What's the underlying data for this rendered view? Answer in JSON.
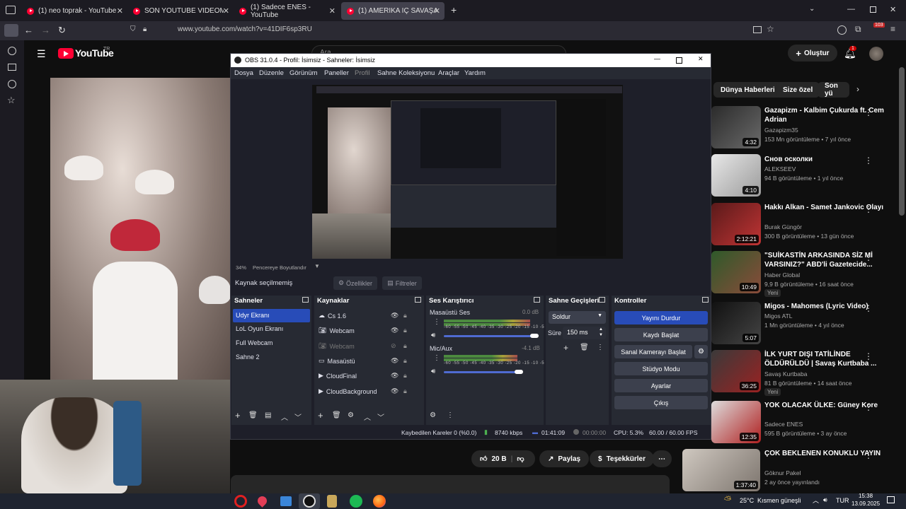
{
  "browser": {
    "tabs": [
      {
        "label": "(1) neo toprak - YouTube"
      },
      {
        "label": "SON YOUTUBE VİDEOM - YouTube"
      },
      {
        "label": "(1) Sadece ENES - YouTube"
      },
      {
        "label": "(1) AMERİKA İÇ SAVAŞA GİDİYOR"
      }
    ],
    "url": "www.youtube.com/watch?v=41DIF6sp3RU",
    "profile_badge": "103"
  },
  "youtube": {
    "logo_text": "YouTube",
    "logo_sup": "TR",
    "create_label": "Oluştur",
    "notif_count": "1",
    "search_placeholder": "Ara",
    "chips": [
      "Dünya Haberleri",
      "Size özel",
      "Son yü"
    ],
    "actions": {
      "likes": "20 B",
      "share": "Paylaş",
      "thanks": "Teşekkürler"
    },
    "related": [
      {
        "title": "Gazapizm - Kalbim Çukurda ft. Cem Adrian",
        "channel": "Gazapizm35",
        "meta": "153 Mn görüntüleme • 7 yıl önce",
        "duration": "4:32"
      },
      {
        "title": "Снов осколки",
        "channel": "ALEKSEEV",
        "meta": "94 B görüntüleme • 1 yıl önce",
        "duration": "4:10"
      },
      {
        "title": "Hakkı Alkan - Samet Jankovic Olayı",
        "channel": "Burak Güngör",
        "meta": "300 B görüntüleme • 13 gün önce",
        "duration": "2:12:21"
      },
      {
        "title": "\"SUİKASTİN ARKASINDA SİZ Mİ VARSINIZ?\" ABD'li Gazetecide...",
        "channel": "Haber Global",
        "meta": "9,9 B görüntüleme • 16 saat önce",
        "duration": "10:49",
        "badge": "Yeni"
      },
      {
        "title": "Migos - Mahomes (Lyric Video)",
        "channel": "Migos ATL",
        "meta": "1 Mn görüntüleme • 4 yıl önce",
        "duration": "5:07"
      },
      {
        "title": "İLK YURT DIŞI TATİLİNDE ÖLDÜRÜLDÜ | Savaş Kurtbaba ...",
        "channel": "Savaş Kurtbaba",
        "meta": "81 B görüntüleme • 14 saat önce",
        "duration": "36:25",
        "badge": "Yeni"
      },
      {
        "title": "YOK OLACAK ÜLKE: Güney Kore",
        "channel": "Sadece ENES",
        "meta": "595 B görüntüleme • 3 ay önce",
        "duration": "12:35"
      },
      {
        "title": "ÇOK BEKLENEN KONUKLU YAYIN",
        "channel": "Göknur Pakel",
        "meta": "2 ay önce yayınlandı",
        "duration": "1:37:40"
      }
    ]
  },
  "obs": {
    "title": "OBS 31.0.4 - Profil: İsimsiz - Sahneler: İsimsiz",
    "menu": [
      "Dosya",
      "Düzenle",
      "Görünüm",
      "Paneller",
      "Profil",
      "Sahne Koleksiyonu",
      "Araçlar",
      "Yardım"
    ],
    "zoom": "34%",
    "window_size_label": "Pencereye Boyutlandır",
    "no_source": "Kaynak seçilmemiş",
    "properties": "Özellikler",
    "filters": "Filtreler",
    "panels": {
      "scenes": "Sahneler",
      "sources": "Kaynaklar",
      "mixer": "Ses Karıştırıcı",
      "transitions": "Sahne Geçişleri",
      "controls": "Kontroller"
    },
    "scenes": [
      "Udyr Ekranı",
      "LoL Oyun Ekranı",
      "Full Webcam",
      "Sahne 2"
    ],
    "sources": [
      "Cs 1.6",
      "Webcam",
      "Webcam",
      "Masaüstü",
      "CloudFinal",
      "CloudBackground"
    ],
    "mixer": [
      {
        "name": "Masaüstü Ses",
        "db": "0.0 dB",
        "level": 0.92
      },
      {
        "name": "Mic/Aux",
        "db": "-4.1 dB",
        "level": 0.78
      }
    ],
    "meter_scale": "-60 -55 -50 -45 -40 -35 -30 -25 -20 -15 -10 -5 0",
    "transition": "Soldur",
    "duration_label": "Süre",
    "duration_value": "150 ms",
    "controls": [
      "Yayını Durdur",
      "Kaydı Başlat",
      "Sanal Kamerayı Başlat",
      "Stüdyo Modu",
      "Ayarlar",
      "Çıkış"
    ],
    "status": {
      "dropped": "Kaybedilen Kareler 0 (%0.0)",
      "bitrate": "8740 kbps",
      "live": "01:41:09",
      "rec": "00:00:00",
      "cpu": "CPU: 5.3%",
      "fps": "60.00 / 60.00 FPS"
    }
  },
  "taskbar": {
    "weather": "25°C",
    "weather_desc": "Kısmen güneşli",
    "lang": "TUR",
    "time": "15:38",
    "date": "13.09.2025"
  }
}
